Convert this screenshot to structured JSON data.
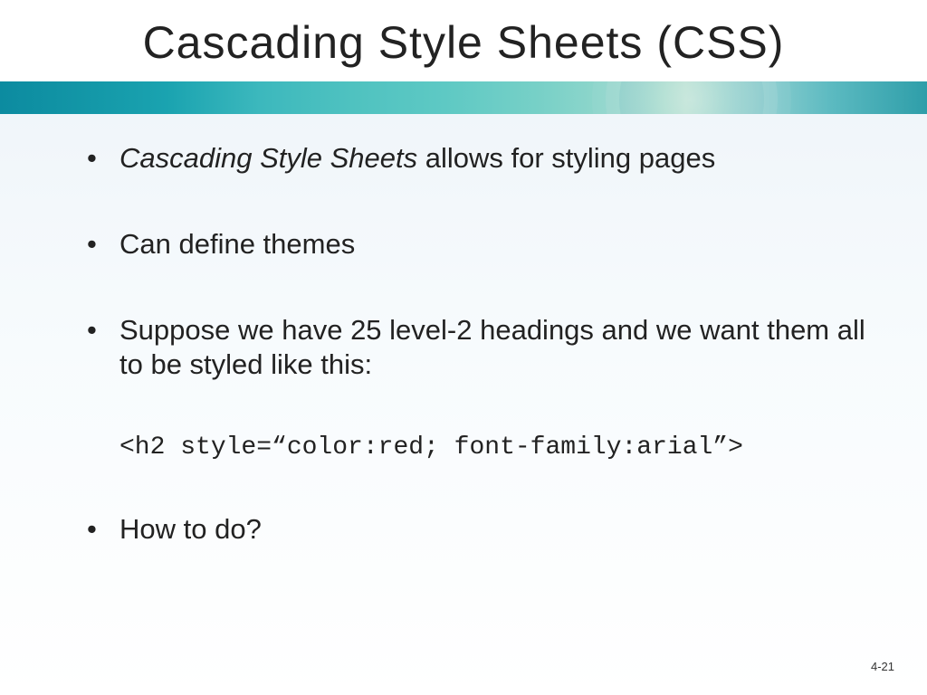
{
  "slide": {
    "title": "Cascading Style Sheets (CSS)",
    "bullets": {
      "b1_ital": "Cascading Style Sheets",
      "b1_rest": " allows for styling pages",
      "b2": "Can define themes",
      "b3": "Suppose we have 25 level-2 headings and we want them all to be styled like this:",
      "code": "<h2 style=“color:red; font-family:arial”>",
      "b4": "How to do?"
    },
    "page_number": "4-21"
  }
}
